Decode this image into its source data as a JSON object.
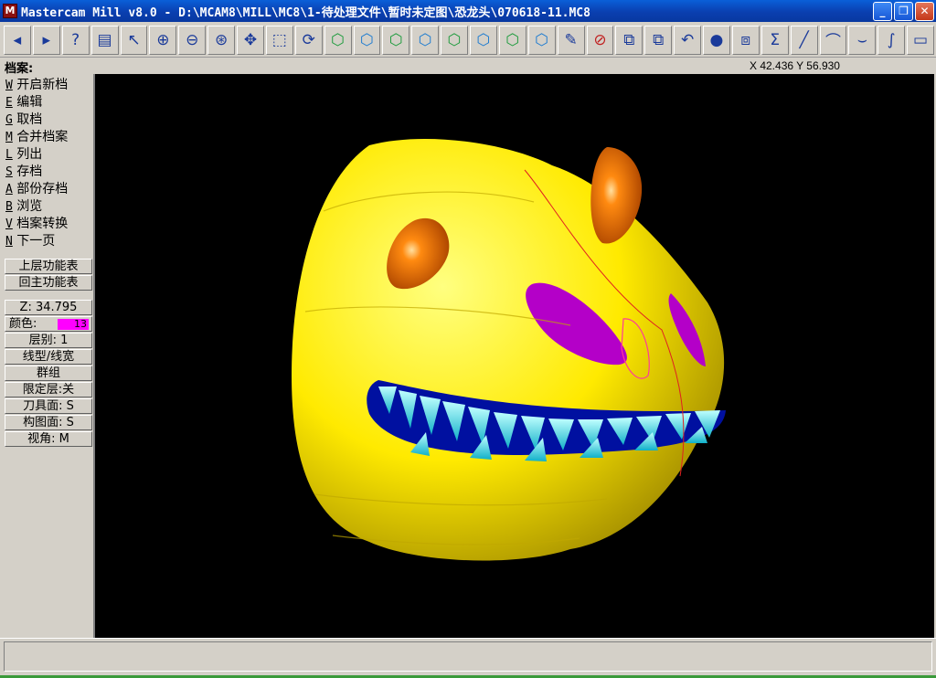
{
  "window": {
    "title": "Mastercam Mill v8.0 - D:\\MCAM8\\MILL\\MC8\\1-待处理文件\\暂时未定图\\恐龙头\\070618-11.MC8",
    "icon_text": "M"
  },
  "window_buttons": {
    "minimize": "_",
    "maximize": "❐",
    "close": "✕"
  },
  "toolbar": {
    "icons": [
      {
        "name": "back-icon",
        "glyph": "◂"
      },
      {
        "name": "forward-icon",
        "glyph": "▸"
      },
      {
        "name": "help-icon",
        "glyph": "?"
      },
      {
        "name": "calculator-icon",
        "glyph": "▤"
      },
      {
        "name": "analyze-icon",
        "glyph": "↖"
      },
      {
        "name": "zoom-icon",
        "glyph": "⊕"
      },
      {
        "name": "unzoom-icon",
        "glyph": "⊖"
      },
      {
        "name": "zoom-fit-icon",
        "glyph": "⊛"
      },
      {
        "name": "pan-icon",
        "glyph": "✥"
      },
      {
        "name": "zoom-window-icon",
        "glyph": "⬚"
      },
      {
        "name": "rotate-icon",
        "glyph": "⟳"
      },
      {
        "name": "view-top-icon",
        "glyph": "⬡"
      },
      {
        "name": "view-front-icon",
        "glyph": "⬡"
      },
      {
        "name": "view-side-icon",
        "glyph": "⬡"
      },
      {
        "name": "view-iso-icon",
        "glyph": "⬡"
      },
      {
        "name": "cplane-top-icon",
        "glyph": "⬡"
      },
      {
        "name": "cplane-front-icon",
        "glyph": "⬡"
      },
      {
        "name": "cplane-side-icon",
        "glyph": "⬡"
      },
      {
        "name": "cplane-3d-icon",
        "glyph": "⬡"
      },
      {
        "name": "clear-color-icon",
        "glyph": "✎"
      },
      {
        "name": "delete-icon",
        "glyph": "⊘"
      },
      {
        "name": "translate-icon",
        "glyph": "⧉"
      },
      {
        "name": "transform-icon",
        "glyph": "⧉"
      },
      {
        "name": "undo-icon",
        "glyph": "↶"
      },
      {
        "name": "shade-icon",
        "glyph": "●"
      },
      {
        "name": "group-icon",
        "glyph": "⧈"
      },
      {
        "name": "sigma-icon",
        "glyph": "Σ"
      },
      {
        "name": "line-icon",
        "glyph": "╱"
      },
      {
        "name": "arc-icon",
        "glyph": "⌒"
      },
      {
        "name": "fillet-icon",
        "glyph": "⌣"
      },
      {
        "name": "spline-icon",
        "glyph": "∫"
      },
      {
        "name": "rectangle-icon",
        "glyph": "▭"
      }
    ]
  },
  "status": {
    "menu_title": "档案:",
    "coords": "X 42.436  Y 56.930"
  },
  "menu": {
    "items": [
      {
        "key": "W",
        "label": "开启新档"
      },
      {
        "key": "E",
        "label": "编辑"
      },
      {
        "key": "G",
        "label": "取档"
      },
      {
        "key": "M",
        "label": "合并档案"
      },
      {
        "key": "L",
        "label": "列出"
      },
      {
        "key": "S",
        "label": "存档"
      },
      {
        "key": "A",
        "label": "部份存档"
      },
      {
        "key": "B",
        "label": "浏览"
      },
      {
        "key": "V",
        "label": "档案转换"
      },
      {
        "key": "N",
        "label": "下一页"
      }
    ]
  },
  "nav": {
    "back": "上层功能表",
    "main": "回主功能表"
  },
  "settings": {
    "z": "Z: 34.795",
    "color_label": "颜色:",
    "color_value": "13",
    "level": "层别: 1",
    "linetype": "线型/线宽",
    "group": "群组",
    "mask": "限定层:关",
    "tplane": "刀具面: S",
    "cplane": "构图面: S",
    "gview": "视角: M"
  },
  "colors": {
    "accent": "#ff00ff",
    "viewport_bg": "#000000",
    "model_yellow": "#ffea00",
    "eye_orange": "#ff7a00",
    "nostril_purple": "#b400c8",
    "teeth_cyan": "#2ee0e8",
    "mouth_blue": "#0010a0"
  },
  "prompt": {
    "text": ""
  }
}
